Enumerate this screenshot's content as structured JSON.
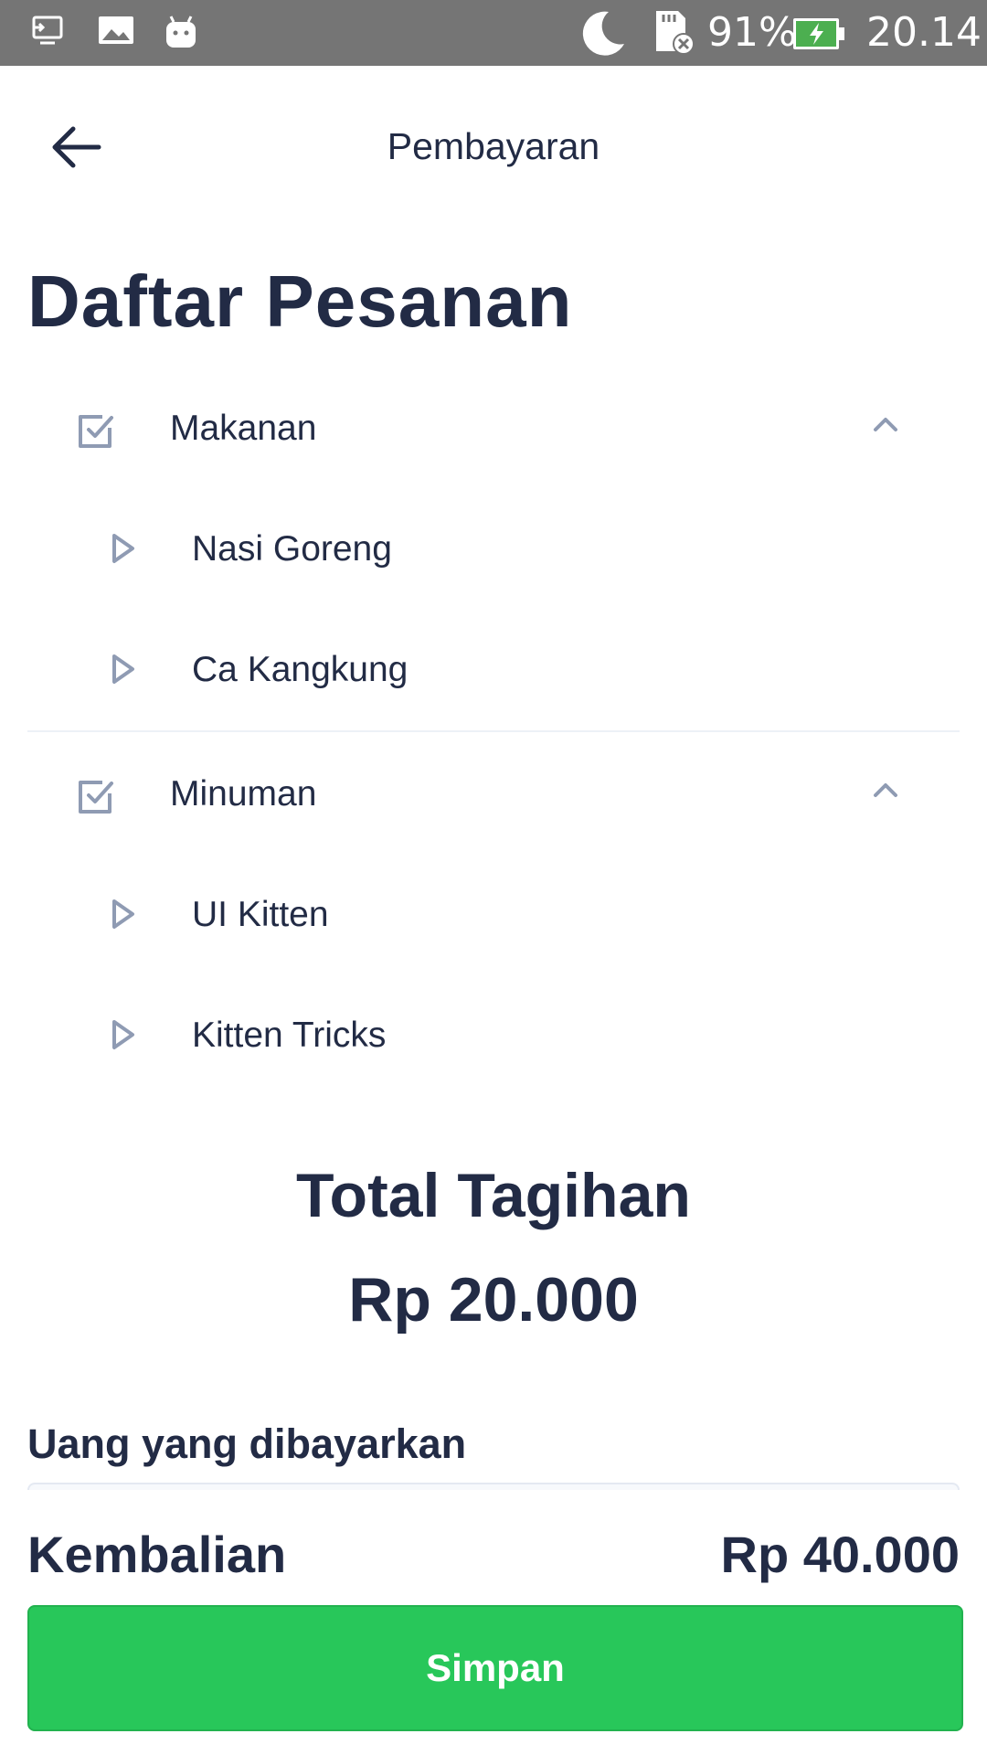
{
  "status_bar": {
    "battery_percent": "91%",
    "time": "20.14",
    "battery_color": "#4caf50",
    "icons": [
      "cast-icon",
      "image-icon",
      "android-icon",
      "moon-icon",
      "sd-card-error-icon",
      "battery-charging-icon"
    ]
  },
  "header": {
    "title": "Pembayaran",
    "back_icon": "arrow-left-icon"
  },
  "order": {
    "title": "Daftar Pesanan",
    "groups": [
      {
        "label": "Makanan",
        "expanded": true,
        "checked": true,
        "items": [
          {
            "label": "Nasi Goreng"
          },
          {
            "label": "Ca Kangkung"
          }
        ]
      },
      {
        "label": "Minuman",
        "expanded": true,
        "checked": true,
        "items": [
          {
            "label": "UI Kitten"
          },
          {
            "label": "Kitten Tricks"
          }
        ]
      }
    ]
  },
  "total": {
    "title": "Total Tagihan",
    "value": "Rp 20.000"
  },
  "payment": {
    "label": "Uang yang dibayarkan",
    "input_value": ""
  },
  "change": {
    "label": "Kembalian",
    "value": "Rp 40.000"
  },
  "actions": {
    "save_label": "Simpan",
    "save_color": "#28c75a"
  },
  "colors": {
    "text": "#222b45",
    "icon": "#8f9bb3",
    "divider": "#edf1f7"
  }
}
